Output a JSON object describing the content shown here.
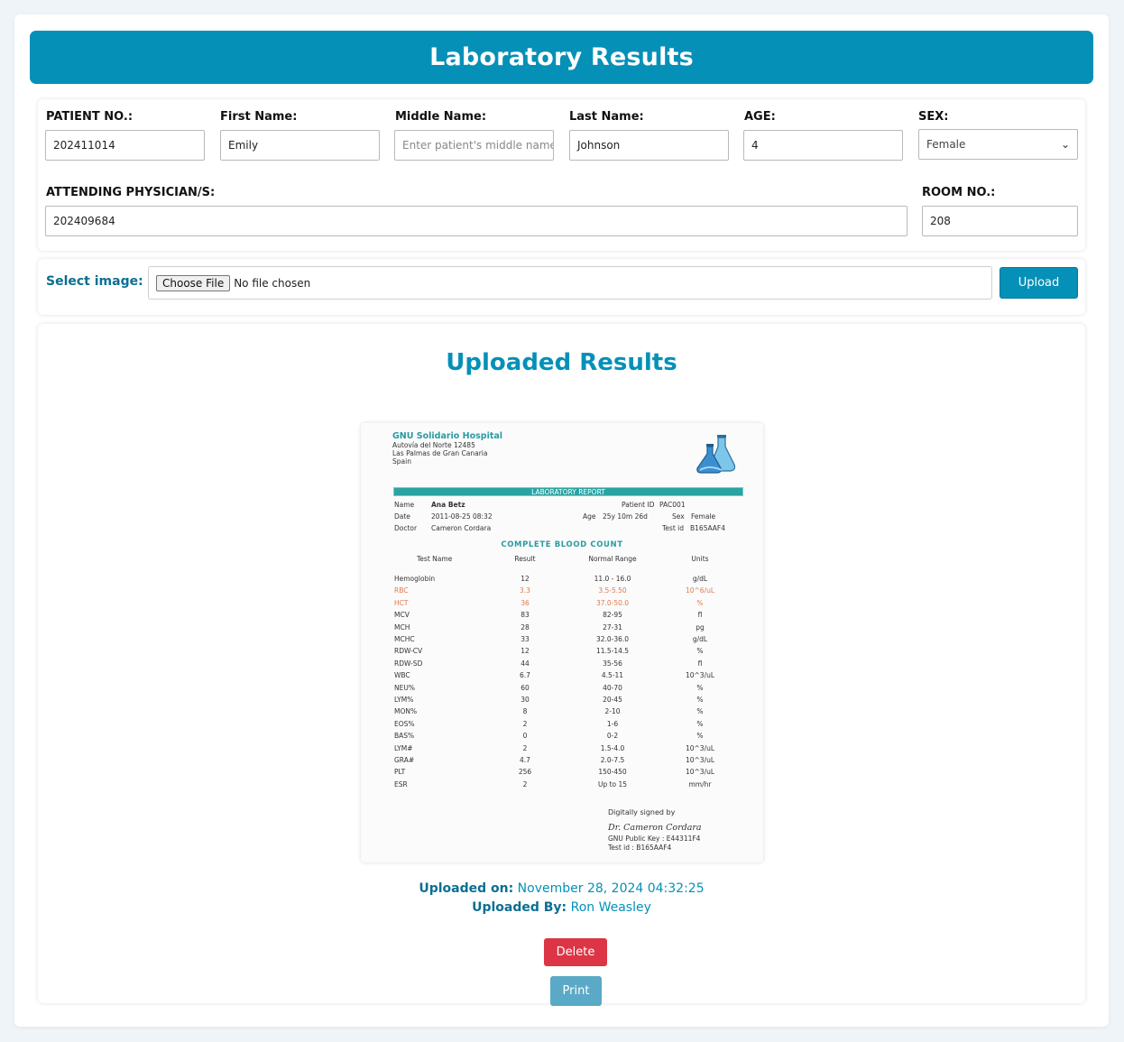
{
  "page": {
    "title": "Laboratory Results"
  },
  "patient": {
    "patient_no_label": "PATIENT NO.:",
    "patient_no": "202411014",
    "first_name_label": "First Name:",
    "first_name": "Emily",
    "middle_name_label": "Middle Name:",
    "middle_name_placeholder": "Enter patient's middle name",
    "last_name_label": "Last Name:",
    "last_name": "Johnson",
    "age_label": "AGE:",
    "age": "4",
    "sex_label": "SEX:",
    "sex": "Female",
    "physician_label": "ATTENDING PHYSICIAN/S:",
    "physician": "202409684",
    "room_label": "ROOM NO.:",
    "room": "208"
  },
  "upload": {
    "label": "Select image:",
    "choose_file": "Choose File",
    "no_file": "No file chosen",
    "button": "Upload"
  },
  "results": {
    "title": "Uploaded Results",
    "uploaded_on_label": "Uploaded on:",
    "uploaded_on": "November 28, 2024 04:32:25",
    "uploaded_by_label": "Uploaded By:",
    "uploaded_by": "Ron Weasley",
    "delete_label": "Delete",
    "print_label": "Print"
  },
  "report": {
    "hospital": "GNU Solidario Hospital",
    "address": [
      "Autovía del Norte 12485",
      "Las Palmas de Gran Canaria",
      "Spain"
    ],
    "banner": "LABORATORY REPORT",
    "name_label": "Name",
    "name": "Ana Betz",
    "date_label": "Date",
    "date": "2011-08-25 08:32",
    "doctor_label": "Doctor",
    "doctor": "Cameron Cordara",
    "patient_id_label": "Patient ID",
    "patient_id": "PAC001",
    "age_label": "Age",
    "age": "25y 10m 26d",
    "sex_label": "Sex",
    "sex": "Female",
    "test_id_label": "Test id",
    "test_id": "B165AAF4",
    "section": "COMPLETE BLOOD COUNT",
    "headers": [
      "Test Name",
      "Result",
      "Normal Range",
      "Units"
    ],
    "rows": [
      {
        "name": "Hemoglobin",
        "result": "12",
        "range": "11.0 - 16.0",
        "units": "g/dL",
        "abnormal": false
      },
      {
        "name": "RBC",
        "result": "3.3",
        "range": "3.5-5.50",
        "units": "10^6/uL",
        "abnormal": true
      },
      {
        "name": "HCT",
        "result": "36",
        "range": "37.0-50.0",
        "units": "%",
        "abnormal": true
      },
      {
        "name": "MCV",
        "result": "83",
        "range": "82-95",
        "units": "fl",
        "abnormal": false
      },
      {
        "name": "MCH",
        "result": "28",
        "range": "27-31",
        "units": "pg",
        "abnormal": false
      },
      {
        "name": "MCHC",
        "result": "33",
        "range": "32.0-36.0",
        "units": "g/dL",
        "abnormal": false
      },
      {
        "name": "RDW-CV",
        "result": "12",
        "range": "11.5-14.5",
        "units": "%",
        "abnormal": false
      },
      {
        "name": "RDW-SD",
        "result": "44",
        "range": "35-56",
        "units": "fl",
        "abnormal": false
      },
      {
        "name": "WBC",
        "result": "6.7",
        "range": "4.5-11",
        "units": "10^3/uL",
        "abnormal": false
      },
      {
        "name": "NEU%",
        "result": "60",
        "range": "40-70",
        "units": "%",
        "abnormal": false
      },
      {
        "name": "LYM%",
        "result": "30",
        "range": "20-45",
        "units": "%",
        "abnormal": false
      },
      {
        "name": "MON%",
        "result": "8",
        "range": "2-10",
        "units": "%",
        "abnormal": false
      },
      {
        "name": "EOS%",
        "result": "2",
        "range": "1-6",
        "units": "%",
        "abnormal": false
      },
      {
        "name": "BAS%",
        "result": "0",
        "range": "0-2",
        "units": "%",
        "abnormal": false
      },
      {
        "name": "LYM#",
        "result": "2",
        "range": "1.5-4.0",
        "units": "10^3/uL",
        "abnormal": false
      },
      {
        "name": "GRA#",
        "result": "4.7",
        "range": "2.0-7.5",
        "units": "10^3/uL",
        "abnormal": false
      },
      {
        "name": "PLT",
        "result": "256",
        "range": "150-450",
        "units": "10^3/uL",
        "abnormal": false
      },
      {
        "name": "ESR",
        "result": "2",
        "range": "Up to 15",
        "units": "mm/hr",
        "abnormal": false
      }
    ],
    "signed_by": "Digitally signed by",
    "signature": "Dr. Cameron Cordara",
    "public_key": "GNU Public Key : E44311F4",
    "sig_test_id": "Test id : B165AAF4"
  },
  "colors": {
    "primary": "#0590b8",
    "danger": "#dc3545",
    "print": "#5aa9c7",
    "abnormal": "#e07a4a",
    "report_accent": "#2aa3a3"
  }
}
